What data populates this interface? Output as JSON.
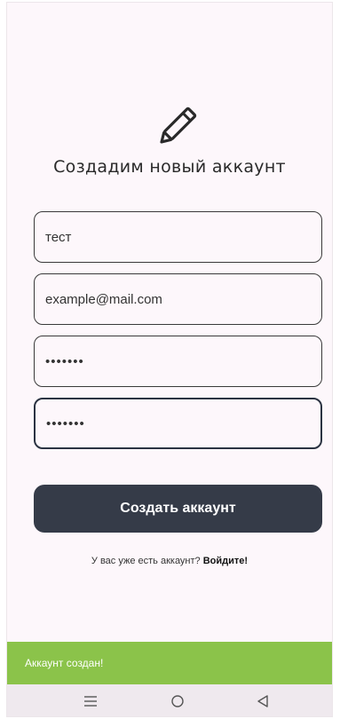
{
  "screen": {
    "title": "Создадим новый аккаунт",
    "header_icon": "pencil-icon"
  },
  "form": {
    "name_value": "тест",
    "email_value": "example@mail.com",
    "password_value": "•••••••",
    "confirm_password_value": "•••••••"
  },
  "actions": {
    "create_button_label": "Создать аккаунт",
    "login_prompt": "У вас уже есть аккаунт? ",
    "login_link": "Войдите!"
  },
  "snackbar": {
    "message": "Аккаунт создан!",
    "color": "#8bc34a"
  },
  "navigation": {
    "menu_icon": "menu-icon",
    "home_icon": "home-circle-icon",
    "back_icon": "back-triangle-icon"
  },
  "colors": {
    "background": "#fdf7fb",
    "button": "#353b48",
    "snackbar": "#8bc34a",
    "navbar": "#efe9ee"
  }
}
